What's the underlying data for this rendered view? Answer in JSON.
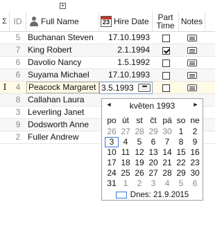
{
  "header": {
    "sigma": "Σ",
    "id": "ID",
    "full_name": "Full Name",
    "hire_date": "Hire Date",
    "part_line1": "Part",
    "part_line2": "Time",
    "notes": "Notes",
    "calendar_icon_day": "23"
  },
  "rows": [
    {
      "id": "5",
      "name": "Buchanan Steven",
      "date": "17.10.1993",
      "part": false
    },
    {
      "id": "7",
      "name": "King Robert",
      "date": "2.1.1994",
      "part": true
    },
    {
      "id": "6",
      "name": "Davolio Nancy",
      "date": "1.5.1992",
      "part": false
    },
    {
      "id": "6",
      "name": "Suyama Michael",
      "date": "17.10.1993",
      "part": false
    },
    {
      "id": "4",
      "name": "Peacock Margaret",
      "date": "3.5.1993",
      "part": false
    },
    {
      "id": "8",
      "name": "Callahan Laura",
      "date": "",
      "part": null
    },
    {
      "id": "3",
      "name": "Leverling Janet",
      "date": "",
      "part": null
    },
    {
      "id": "9",
      "name": "Dodsworth Anne",
      "date": "",
      "part": null
    },
    {
      "id": "2",
      "name": "Fuller Andrew",
      "date": "",
      "part": null
    }
  ],
  "active_row": {
    "indicator": "I",
    "editor_value": "3.5.1993",
    "editor_button": "•••"
  },
  "calendar": {
    "prev": "◄",
    "next": "►",
    "month_title": "květen 1993",
    "weekdays": [
      "po",
      "út",
      "st",
      "čt",
      "pá",
      "so",
      "ne"
    ],
    "weeks": [
      [
        "26",
        "27",
        "28",
        "29",
        "30",
        "1",
        "2"
      ],
      [
        "3",
        "4",
        "5",
        "6",
        "7",
        "8",
        "9"
      ],
      [
        "10",
        "11",
        "12",
        "13",
        "14",
        "15",
        "16"
      ],
      [
        "17",
        "18",
        "19",
        "20",
        "21",
        "22",
        "23"
      ],
      [
        "24",
        "25",
        "26",
        "27",
        "28",
        "29",
        "30"
      ],
      [
        "31",
        "1",
        "2",
        "3",
        "4",
        "5",
        "6"
      ]
    ],
    "today_label": "Dnes: 21.9.2015",
    "accent_color": "#3a78d8"
  }
}
